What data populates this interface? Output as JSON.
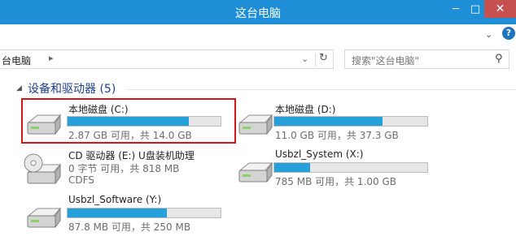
{
  "window": {
    "title": "这台电脑",
    "min_icon": "minimize-icon",
    "max_icon": "maximize-icon",
    "close_icon": "close-icon"
  },
  "address": {
    "path": "台电脑",
    "refresh_icon": "refresh-icon"
  },
  "search": {
    "placeholder": "搜索\"这台电脑\""
  },
  "group": {
    "label": "设备和驱动器 (5)"
  },
  "drives": [
    {
      "name": "本地磁盘 (C:)",
      "space": "2.87 GB 可用，共 14.0 GB",
      "fill": 0.795,
      "selected": true
    },
    {
      "name": "本地磁盘 (D:)",
      "space": "11.0 GB 可用，共 37.3 GB",
      "fill": 0.705
    },
    {
      "name": "CD 驱动器 (E:) U盘装机助理",
      "space": "0 字节 可用，共 818 MB",
      "fs": "CDFS"
    },
    {
      "name": "Usbzl_System (X:)",
      "space": "785 MB 可用，共 1.00 GB",
      "fill": 0.233
    },
    {
      "name": "Usbzl_Software (Y:)",
      "space": "87.8 MB 可用，共 250 MB",
      "fill": 0.649
    }
  ],
  "colors": {
    "titlebar": "#1e8fd6",
    "bar_fill": "#26a0da",
    "selection_border": "#d3161c",
    "group_text": "#1e3f8a"
  }
}
